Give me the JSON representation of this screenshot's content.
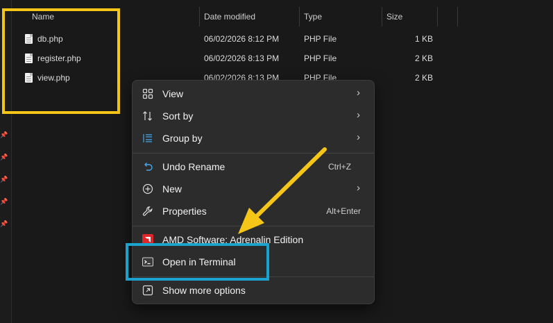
{
  "columns": {
    "name": "Name",
    "date_modified": "Date modified",
    "type": "Type",
    "size": "Size"
  },
  "files": [
    {
      "name": "db.php",
      "date": "06/02/2026 8:12 PM",
      "type": "PHP File",
      "size": "1 KB"
    },
    {
      "name": "register.php",
      "date": "06/02/2026 8:13 PM",
      "type": "PHP File",
      "size": "2 KB"
    },
    {
      "name": "view.php",
      "date": "06/02/2026 8:13 PM",
      "type": "PHP File",
      "size": "2 KB"
    }
  ],
  "context_menu": {
    "view": "View",
    "sort_by": "Sort by",
    "group_by": "Group by",
    "undo_rename": "Undo Rename",
    "undo_shortcut": "Ctrl+Z",
    "new": "New",
    "properties": "Properties",
    "properties_shortcut": "Alt+Enter",
    "amd": "AMD Software: Adrenalin Edition",
    "open_terminal": "Open in Terminal",
    "show_more": "Show more options"
  },
  "icons": {
    "view": "view-grid-icon",
    "sort": "sort-icon",
    "group": "group-by-icon",
    "undo": "undo-icon",
    "new": "new-plus-icon",
    "properties": "properties-wrench-icon",
    "amd": "amd-logo-icon",
    "terminal": "terminal-icon",
    "show_more": "show-more-icon",
    "file": "php-file-icon",
    "pin": "pin-icon"
  },
  "colors": {
    "background": "#191919",
    "menu_bg": "#2c2c2c",
    "highlight_yellow": "#f5c518",
    "highlight_blue": "#1aa3cf",
    "amd_red": "#e0262a"
  }
}
